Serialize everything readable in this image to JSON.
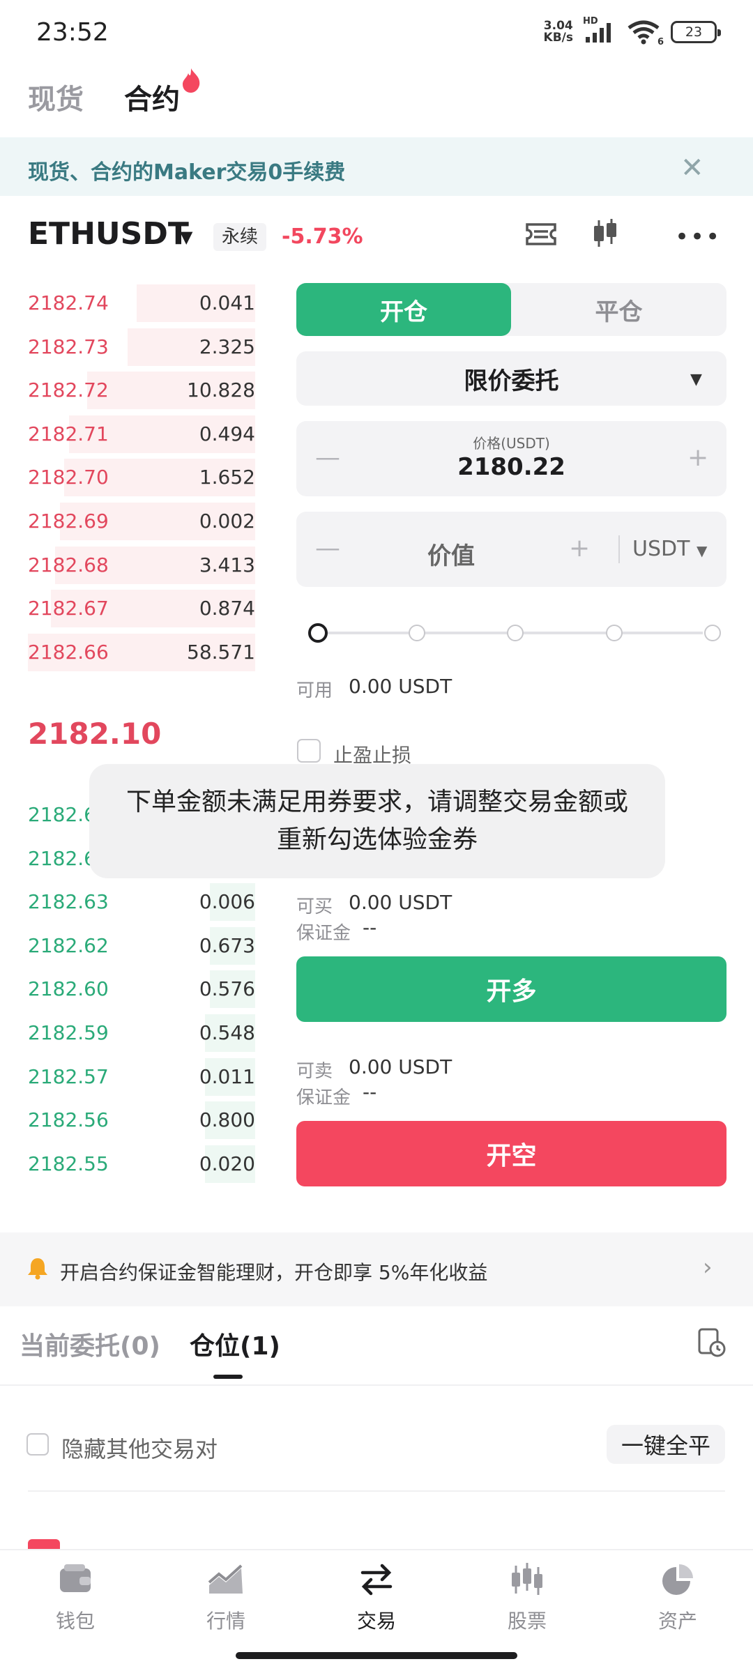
{
  "status_bar": {
    "time": "23:52",
    "net_speed_value": "3.04",
    "net_speed_unit": "KB/s",
    "net_type": "HD",
    "wifi_sub": "6",
    "battery": "23"
  },
  "top_tabs": {
    "spot": "现货",
    "futures": "合约"
  },
  "banner": {
    "text": "现货、合约的Maker交易0手续费"
  },
  "symbol": {
    "name": "ETHUSDT",
    "type": "永续",
    "change": "-5.73%"
  },
  "order_book": {
    "asks": [
      {
        "price": "2182.74",
        "qty": "0.041",
        "depth": 0.52
      },
      {
        "price": "2182.73",
        "qty": "2.325",
        "depth": 0.56
      },
      {
        "price": "2182.72",
        "qty": "10.828",
        "depth": 0.74
      },
      {
        "price": "2182.71",
        "qty": "0.494",
        "depth": 0.82
      },
      {
        "price": "2182.70",
        "qty": "1.652",
        "depth": 0.84
      },
      {
        "price": "2182.69",
        "qty": "0.002",
        "depth": 0.86
      },
      {
        "price": "2182.68",
        "qty": "3.413",
        "depth": 0.88
      },
      {
        "price": "2182.67",
        "qty": "0.874",
        "depth": 0.9
      },
      {
        "price": "2182.66",
        "qty": "58.571",
        "depth": 1.0
      }
    ],
    "last_price": "2182.10",
    "bids": [
      {
        "price": "2182.6",
        "qty": "",
        "depth": 0.2
      },
      {
        "price": "2182.6",
        "qty": "",
        "depth": 0.2
      },
      {
        "price": "2182.63",
        "qty": "0.006",
        "depth": 0.2
      },
      {
        "price": "2182.62",
        "qty": "0.673",
        "depth": 0.2
      },
      {
        "price": "2182.60",
        "qty": "0.576",
        "depth": 0.2
      },
      {
        "price": "2182.59",
        "qty": "0.548",
        "depth": 0.22
      },
      {
        "price": "2182.57",
        "qty": "0.011",
        "depth": 0.22
      },
      {
        "price": "2182.56",
        "qty": "0.800",
        "depth": 0.22
      },
      {
        "price": "2182.55",
        "qty": "0.020",
        "depth": 0.22
      }
    ]
  },
  "order_panel": {
    "open_tab": "开仓",
    "close_tab": "平仓",
    "order_type": "限价委托",
    "price_label": "价格(USDT)",
    "price_value": "2180.22",
    "value_placeholder": "价值",
    "unit": "USDT",
    "slider_fraction": 0,
    "available_label": "可用",
    "available_value": "0.00 USDT",
    "tp_sl_label": "止盈止损",
    "buyable_label": "可买",
    "buyable_value": "0.00 USDT",
    "margin_label": "保证金",
    "margin_value": "--",
    "long_button": "开多",
    "sellable_label": "可卖",
    "sellable_value": "0.00 USDT",
    "margin2_label": "保证金",
    "margin2_value": "--",
    "short_button": "开空"
  },
  "toast": {
    "text": "下单金额未满足用券要求，请调整交易金额或重新勾选体验金券"
  },
  "promo": {
    "text": "开启合约保证金智能理财，开仓即享 5%年化收益"
  },
  "positions": {
    "tab_orders": "当前委托(0)",
    "tab_positions": "仓位(1)",
    "hide_others_label": "隐藏其他交易对",
    "close_all_button": "一键全平"
  },
  "bottom_nav": [
    {
      "label": "钱包",
      "icon": "wallet-icon"
    },
    {
      "label": "行情",
      "icon": "market-chart-icon"
    },
    {
      "label": "交易",
      "icon": "trade-swap-icon"
    },
    {
      "label": "股票",
      "icon": "stocks-candle-icon"
    },
    {
      "label": "资产",
      "icon": "assets-pie-icon"
    }
  ],
  "colors": {
    "green": "#2cb67d",
    "red": "#f4475f",
    "banner_text": "#3a7a82"
  }
}
